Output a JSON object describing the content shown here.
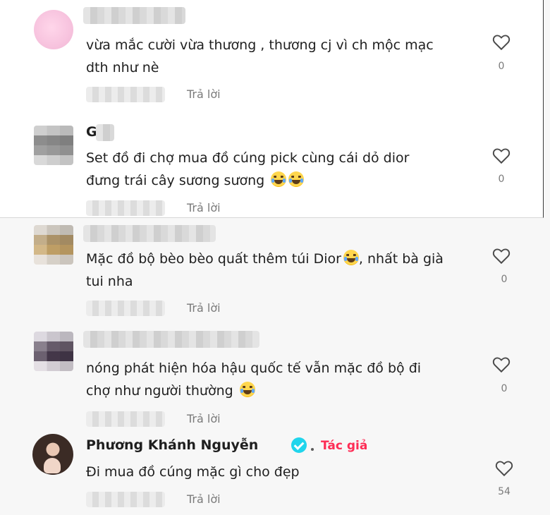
{
  "comments": [
    {
      "text_lines": [
        "vừa mắc cười vừa thương , thương cj vì ch mộc mạc",
        "dth như nè"
      ],
      "reply": "Trả lời",
      "likes": "0"
    },
    {
      "author_partial": "G",
      "text_lines": [
        "Set đồ đi chợ mua đồ cúng pick cùng cái dỏ dior",
        "đưng trái cây sương sương"
      ],
      "reply": "Trả lời",
      "likes": "0"
    },
    {
      "text_lines": [
        "Mặc đồ bộ bèo bèo quất thêm túi Dior",
        "tui nha"
      ],
      "text_line1_suffix": ", nhất bà già",
      "reply": "Trả lời",
      "likes": "0"
    },
    {
      "text_lines": [
        "nóng phát hiện hóa hậu quốc tế vẫn mặc đồ bộ đi",
        "chợ như người thường"
      ],
      "reply": "Trả lời",
      "likes": "0"
    },
    {
      "author": "Phương Khánh Nguyễn",
      "author_tag": "Tác giả",
      "text_lines": [
        "Đi mua đồ cúng mặc gì cho đẹp"
      ],
      "reply": "Trả lời",
      "likes": "54"
    }
  ],
  "icons": {
    "like": "heart-outline-icon",
    "emoji": "grinning-squinting-face-emoji",
    "badge": "verified-badge-icon"
  },
  "colors": {
    "author_tag": "#fe2c55",
    "verified": "#20d5ec",
    "muted": "#7a7a7a"
  }
}
